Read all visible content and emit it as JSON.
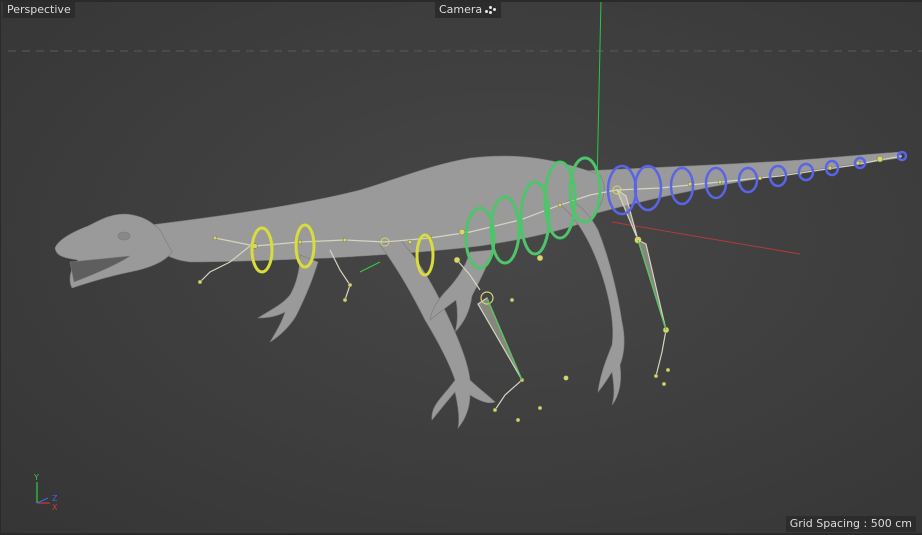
{
  "viewport": {
    "view_name": "Perspective",
    "camera_label": "Camera",
    "camera_icon": "camera-icon",
    "grid_spacing": "Grid Spacing : 500 cm"
  },
  "gizmo": {
    "y_label": "Y",
    "z_label": "Z",
    "x_label": "X"
  },
  "colors": {
    "background": "#3f3f3f",
    "mesh": "#9b9b9b",
    "joint": "#c8c8a0",
    "joint_yellow": "#e6e65a",
    "spine_ring_green": "#4fc46a",
    "tail_ring_blue": "#5a64e6",
    "leg_ring_yellow": "#d8dc3c",
    "y_axis": "#3cc84a",
    "x_axis": "#c83c3c",
    "z_axis": "#3c6cd8"
  }
}
